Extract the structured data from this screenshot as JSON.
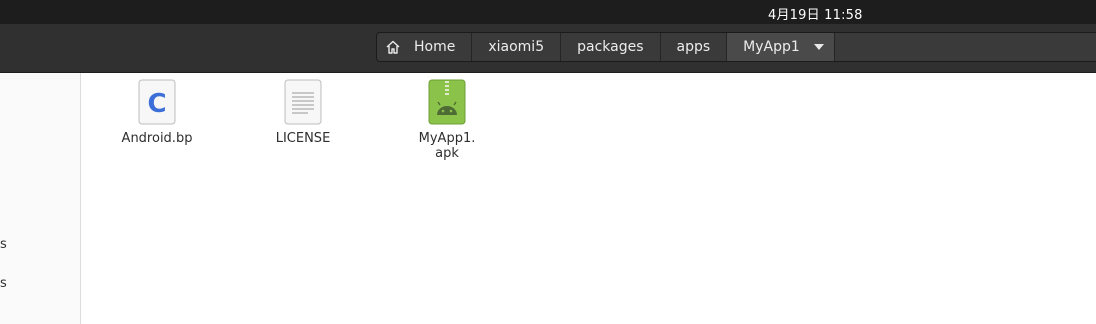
{
  "topbar": {
    "clock": "4月19日  11:58"
  },
  "pathbar": {
    "crumbs": [
      "Home",
      "xiaomi5",
      "packages",
      "apps",
      "MyApp1"
    ]
  },
  "sidebar": {
    "fragments": [
      "s",
      "s"
    ]
  },
  "files": [
    {
      "line1": "Android.bp",
      "line2": "",
      "icon": "c-source-file-icon",
      "glyph": "C"
    },
    {
      "line1": "LICENSE",
      "line2": "",
      "icon": "text-document-icon"
    },
    {
      "line1": "MyApp1.",
      "line2": "apk",
      "icon": "android-apk-icon"
    }
  ],
  "colors": {
    "accent_green": "#8bc34a",
    "c_blue": "#3d6fd8"
  }
}
